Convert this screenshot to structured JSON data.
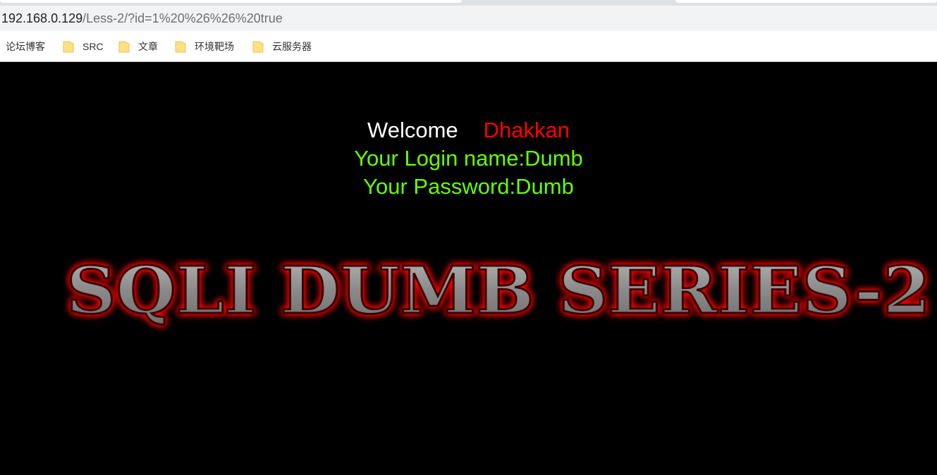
{
  "browser": {
    "url_host": "192.168.0.129",
    "url_path": "/Less-2/?id=1%20%26%26%20true",
    "bookmarks": [
      {
        "label": "论坛博客",
        "icon": "none"
      },
      {
        "label": "SRC",
        "icon": "folder-icon"
      },
      {
        "label": "文章",
        "icon": "folder-icon"
      },
      {
        "label": "环境靶场",
        "icon": "folder-icon"
      },
      {
        "label": "云服务器",
        "icon": "folder-icon"
      }
    ]
  },
  "page": {
    "welcome_label": "Welcome",
    "welcome_name": "Dhakkan",
    "login_line": "Your Login name:Dumb",
    "password_line": "Your Password:Dumb",
    "banner_text": "SQLI DUMB SERIES-2"
  },
  "colors": {
    "background": "#000000",
    "welcome": "#ffffff",
    "name": "#ff0000",
    "credentials": "#66ff00",
    "banner_fill": "#8c8c8c",
    "banner_glow": "#ff0000"
  }
}
